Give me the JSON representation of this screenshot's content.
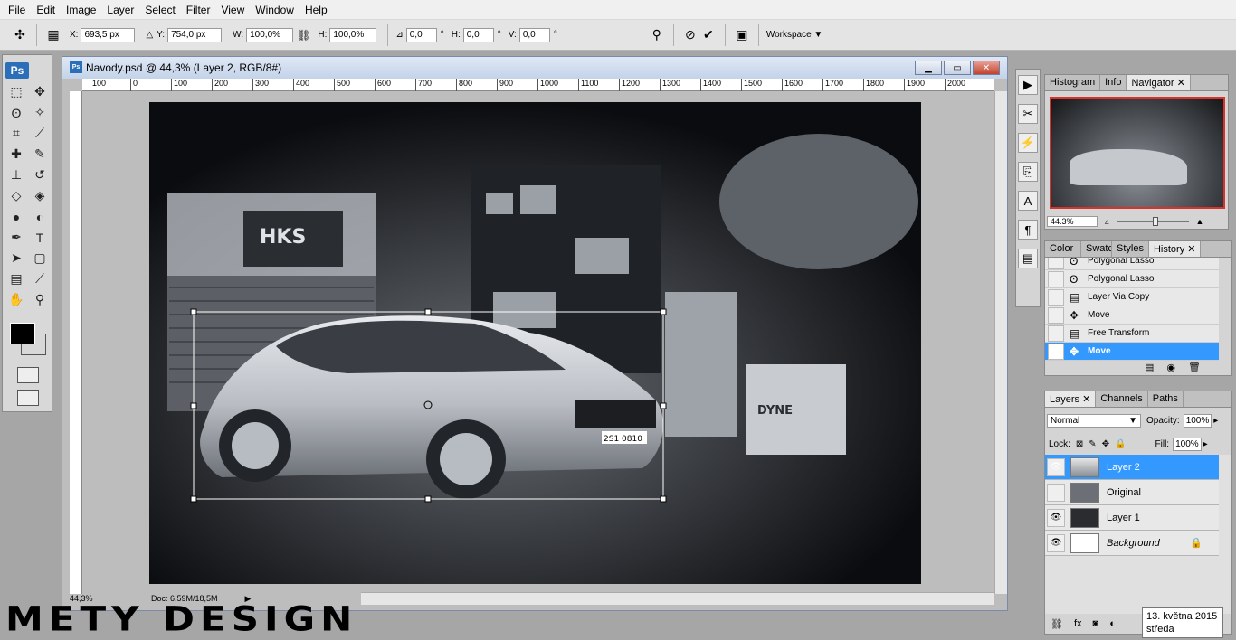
{
  "menubar": [
    "File",
    "Edit",
    "Image",
    "Layer",
    "Select",
    "Filter",
    "View",
    "Window",
    "Help"
  ],
  "options": {
    "x_label": "X:",
    "x_value": "693,5 px",
    "y_label": "Y:",
    "y_value": "754,0 px",
    "w_label": "W:",
    "w_value": "100,0%",
    "h_label": "H:",
    "h_value": "100,0%",
    "angle_value": "0,0",
    "deg": "°",
    "hskew_label": "H:",
    "hskew_value": "0,0",
    "vskew_label": "V:",
    "vskew_value": "0,0",
    "workspace": "Workspace"
  },
  "toolbox": {
    "logo": "Ps"
  },
  "document": {
    "title": "Navody.psd @ 44,3% (Layer 2, RGB/8#)",
    "ruler_labels": [
      "100",
      "0",
      "100",
      "200",
      "300",
      "400",
      "500",
      "600",
      "700",
      "800",
      "900",
      "1000",
      "1100",
      "1200",
      "1300",
      "1400",
      "1500",
      "1600",
      "1700",
      "1800",
      "1900",
      "2000"
    ],
    "status_zoom": "44,3%",
    "status_doc": "Doc: 6,59M/18,5M",
    "plate": "2S1 0810"
  },
  "navigator": {
    "tabs": [
      "Histogram",
      "Info",
      "Navigator"
    ],
    "zoom": "44.3%"
  },
  "history": {
    "tabs": [
      "Color",
      "Swatc",
      "Styles",
      "History"
    ],
    "items": [
      {
        "label": "Polygonal Lasso",
        "icon": "lasso-icon"
      },
      {
        "label": "Polygonal Lasso",
        "icon": "lasso-icon"
      },
      {
        "label": "Layer Via Copy",
        "icon": "doc-icon"
      },
      {
        "label": "Move",
        "icon": "move-icon"
      },
      {
        "label": "Free Transform",
        "icon": "doc-icon"
      },
      {
        "label": "Move",
        "icon": "move-icon"
      }
    ]
  },
  "layers": {
    "tabs": [
      "Layers",
      "Channels",
      "Paths"
    ],
    "blend_mode": "Normal",
    "opacity_label": "Opacity:",
    "opacity": "100%",
    "lock_label": "Lock:",
    "fill_label": "Fill:",
    "fill": "100%",
    "items": [
      {
        "name": "Layer 2",
        "visible": true
      },
      {
        "name": "Original",
        "visible": false
      },
      {
        "name": "Layer 1",
        "visible": true
      },
      {
        "name": "Background",
        "visible": true
      }
    ]
  },
  "tooltip": {
    "line1": "13. května 2015",
    "line2": "středa"
  },
  "watermark": "METY DESIGN",
  "colors": {
    "selection": "#3399ff",
    "foreground": "#000000",
    "background": "#d8d8d8"
  }
}
